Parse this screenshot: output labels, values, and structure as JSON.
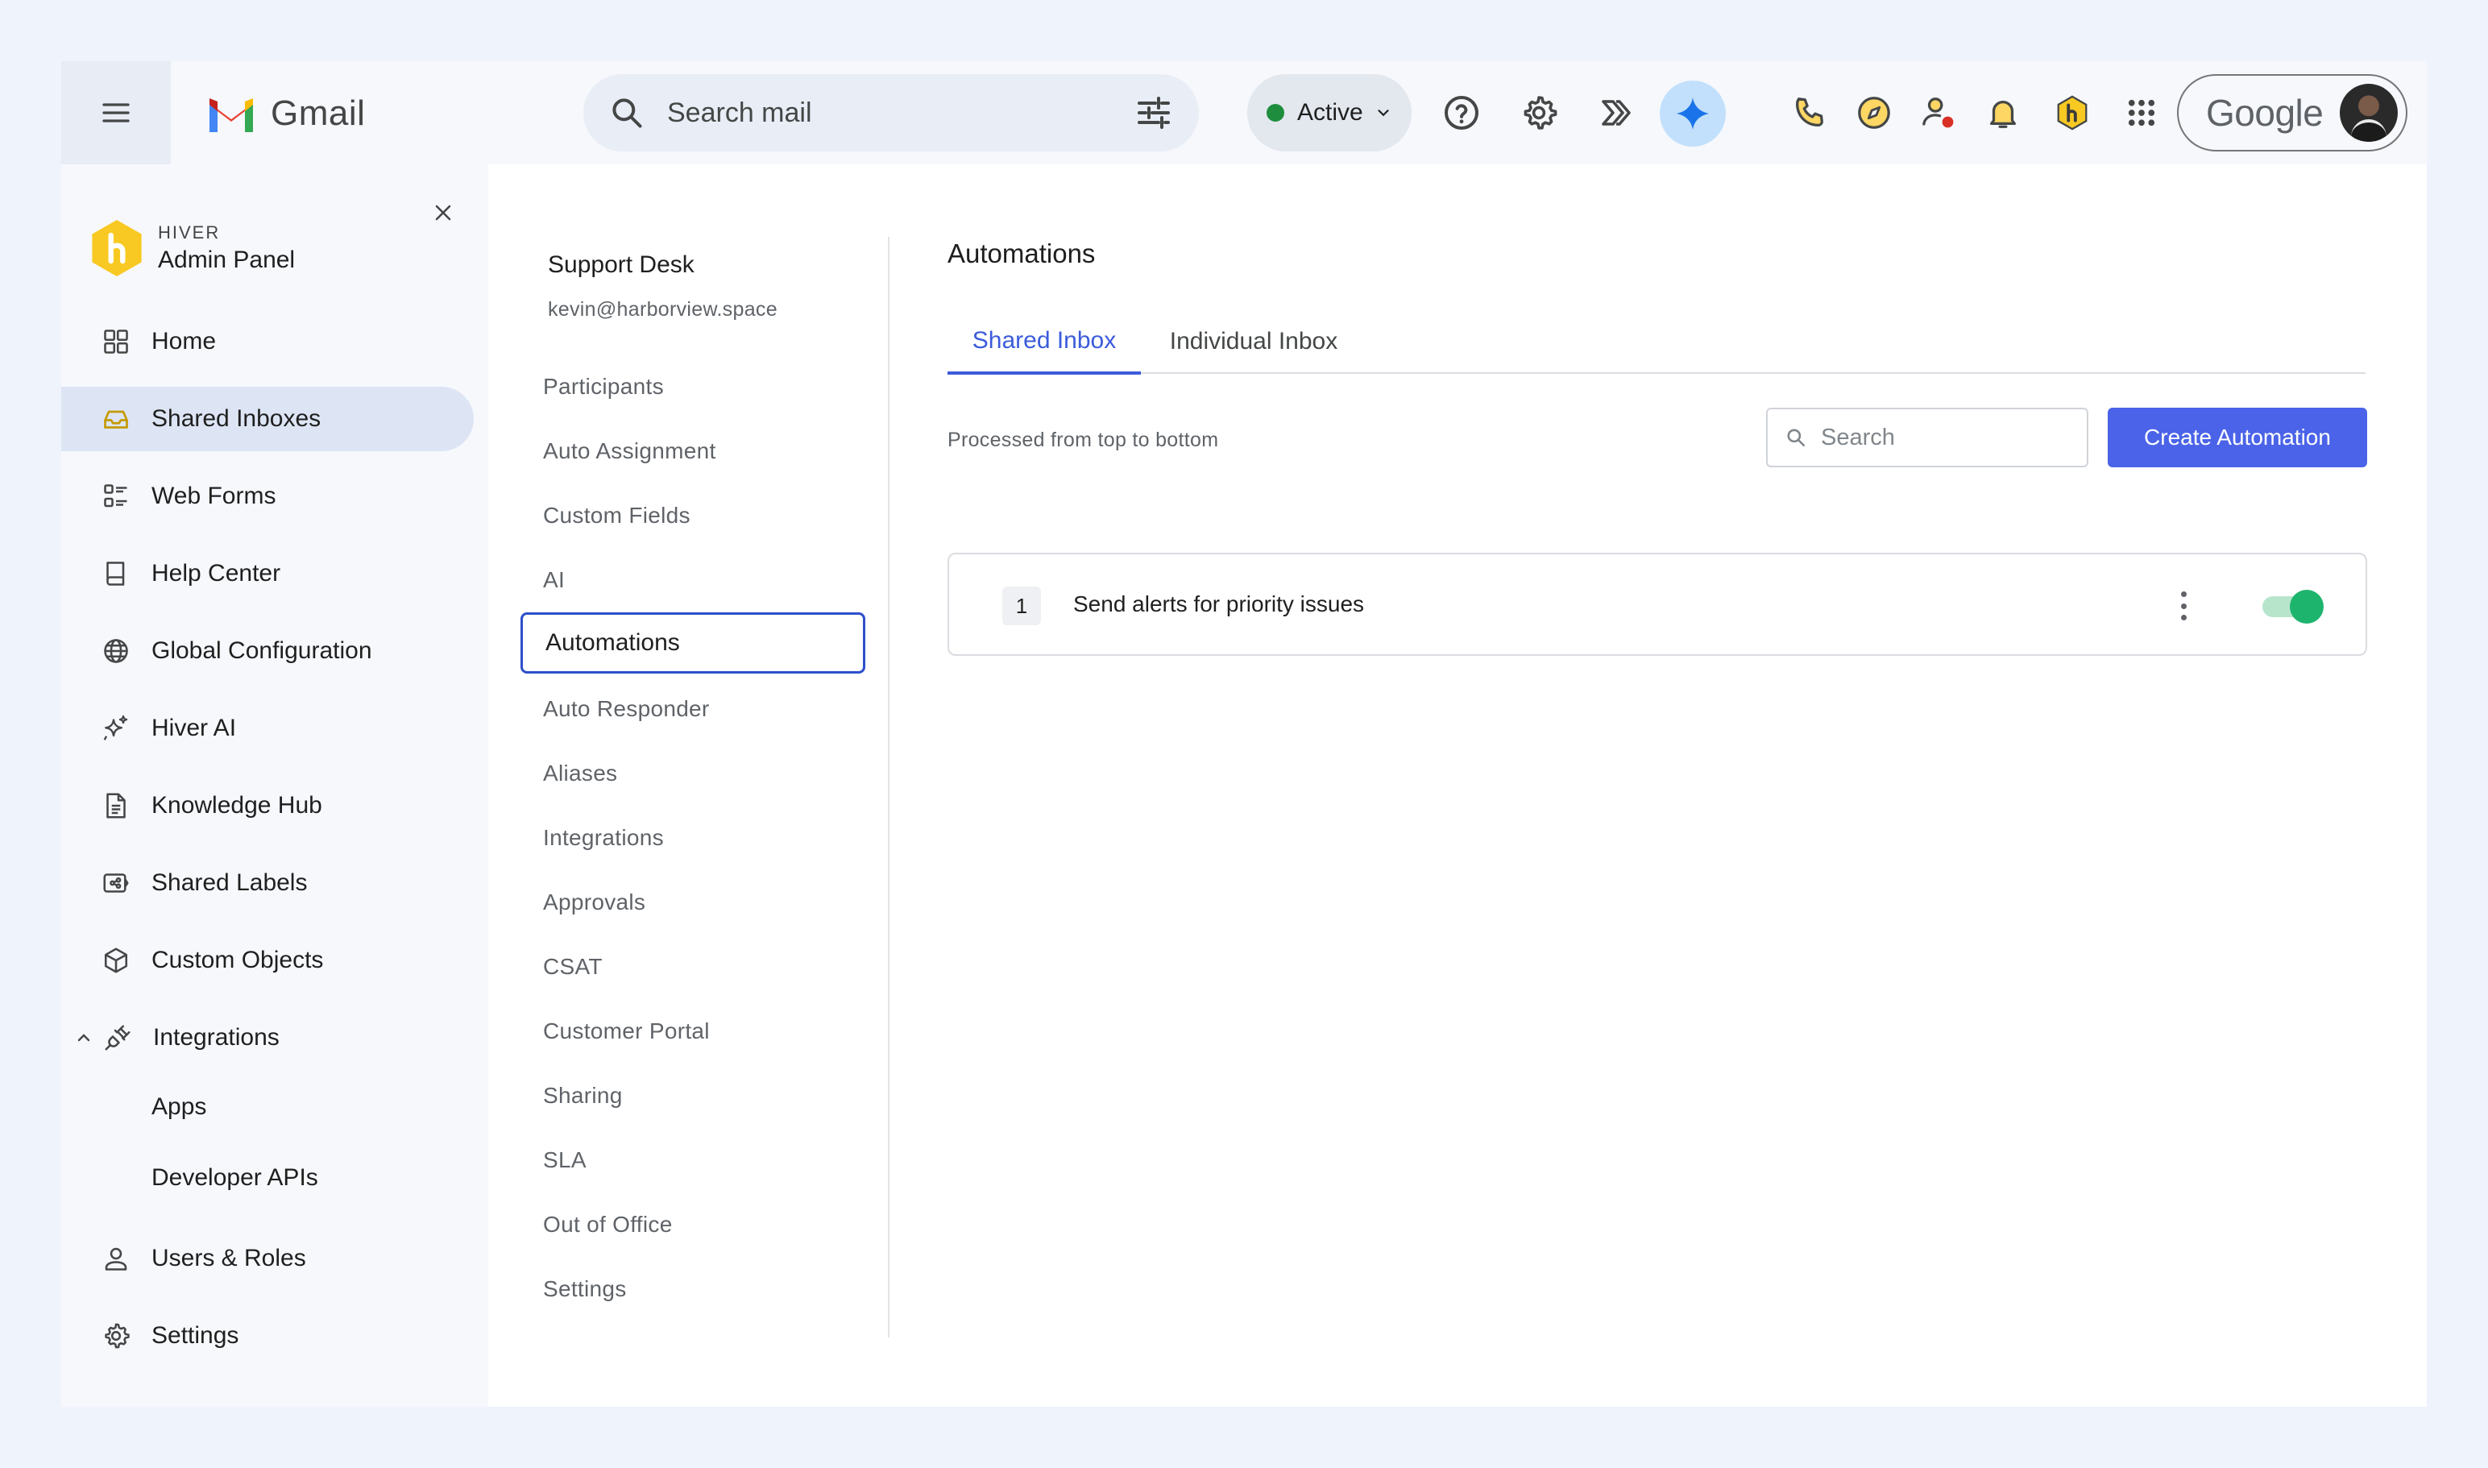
{
  "app": {
    "name": "Gmail"
  },
  "search": {
    "placeholder": "Search mail"
  },
  "status": {
    "label": "Active",
    "color": "#1e8e3e"
  },
  "account": {
    "brand": "Google"
  },
  "hiver": {
    "brand": "HIVER",
    "title": "Admin Panel"
  },
  "nav": {
    "items": [
      {
        "label": "Home"
      },
      {
        "label": "Shared Inboxes"
      },
      {
        "label": "Web Forms"
      },
      {
        "label": "Help Center"
      },
      {
        "label": "Global Configuration"
      },
      {
        "label": "Hiver AI"
      },
      {
        "label": "Knowledge Hub"
      },
      {
        "label": "Shared Labels"
      },
      {
        "label": "Custom Objects"
      },
      {
        "label": "Integrations"
      },
      {
        "label": "Users & Roles"
      },
      {
        "label": "Settings"
      }
    ],
    "integrations_sub": [
      {
        "label": "Apps"
      },
      {
        "label": "Developer APIs"
      }
    ]
  },
  "inbox": {
    "name": "Support Desk",
    "email": "kevin@harborview.space"
  },
  "subnav": {
    "items": [
      {
        "label": "Participants"
      },
      {
        "label": "Auto Assignment"
      },
      {
        "label": "Custom Fields"
      },
      {
        "label": "AI"
      },
      {
        "label": "Automations"
      },
      {
        "label": "Auto Responder"
      },
      {
        "label": "Aliases"
      },
      {
        "label": "Integrations"
      },
      {
        "label": "Approvals"
      },
      {
        "label": "CSAT"
      },
      {
        "label": "Customer Portal"
      },
      {
        "label": "Sharing"
      },
      {
        "label": "SLA"
      },
      {
        "label": "Out of Office"
      },
      {
        "label": "Settings"
      }
    ]
  },
  "main": {
    "title": "Automations",
    "tabs": [
      {
        "label": "Shared Inbox"
      },
      {
        "label": "Individual Inbox"
      }
    ],
    "processed_note": "Processed from top to bottom",
    "search_placeholder": "Search",
    "create_label": "Create Automation",
    "accent": "#4a63e8",
    "rules": [
      {
        "order": "1",
        "name": "Send alerts for priority issues",
        "enabled": true
      }
    ]
  }
}
